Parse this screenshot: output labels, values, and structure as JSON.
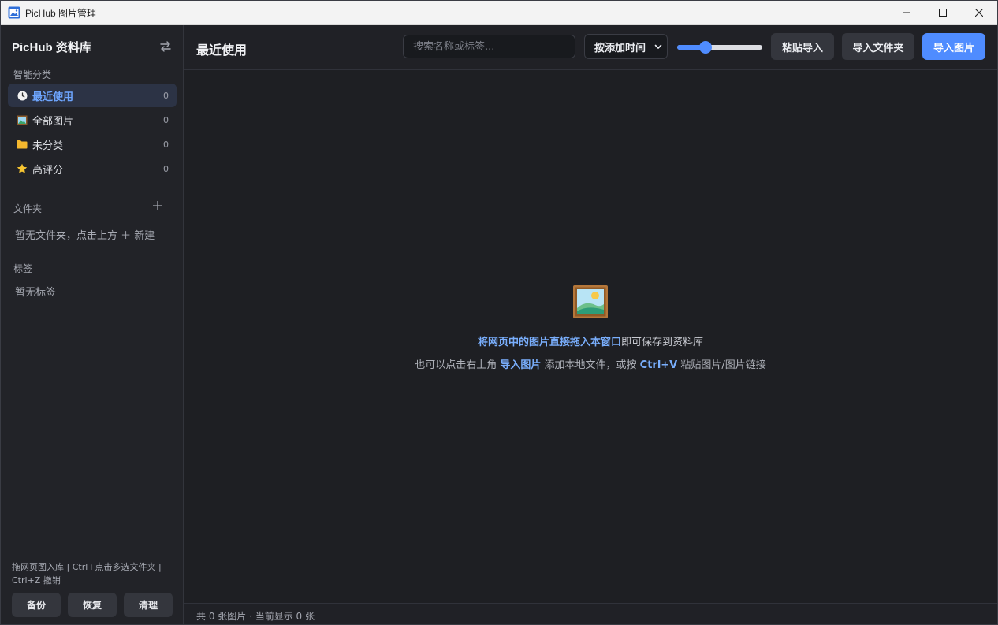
{
  "window": {
    "title": "PicHub 图片管理",
    "icons": {
      "app": "picture-icon",
      "minimize": "minimize-icon",
      "maximize": "maximize-icon",
      "close": "close-icon"
    }
  },
  "sidebar": {
    "title": "PicHub 资料库",
    "switch_icon": "swap-arrows-icon",
    "smart_label": "智能分类",
    "items": [
      {
        "label": "最近使用",
        "count": "0",
        "icon": "clock-icon",
        "active": true
      },
      {
        "label": "全部图片",
        "count": "0",
        "icon": "image-icon",
        "active": false
      },
      {
        "label": "未分类",
        "count": "0",
        "icon": "folder-icon",
        "active": false
      },
      {
        "label": "高评分",
        "count": "0",
        "icon": "star-icon",
        "active": false
      }
    ],
    "folders_label": "文件夹",
    "folders_empty": "暂无文件夹，点击上方 ＋ 新建",
    "tags_label": "标签",
    "tags_empty": "暂无标签",
    "hint": "拖网页图入库 | Ctrl+点击多选文件夹 | Ctrl+Z 撤销",
    "buttons": {
      "backup": "备份",
      "restore": "恢复",
      "clean": "清理"
    }
  },
  "toolbar": {
    "title": "最近使用",
    "search_placeholder": "搜索名称或标签...",
    "sort_value": "按添加时间",
    "size_level": 0.3,
    "paste_import": "粘贴导入",
    "import_folder": "导入文件夹",
    "import_images": "导入图片"
  },
  "empty": {
    "line1_bold": "将网页中的图片直接拖入本窗口",
    "line1_rest": "即可保存到资料库",
    "line2_a": "也可以点击右上角 ",
    "line2_b": "导入图片",
    "line2_c": " 添加本地文件，或按 ",
    "line2_d": "Ctrl+V",
    "line2_e": " 粘贴图片/图片链接"
  },
  "status": "共 0 张图片 · 当前显示 0 张",
  "colors": {
    "accent": "#4f8cff",
    "bg": "#1e1f23",
    "sidebar": "#222328",
    "button": "#34363d"
  }
}
